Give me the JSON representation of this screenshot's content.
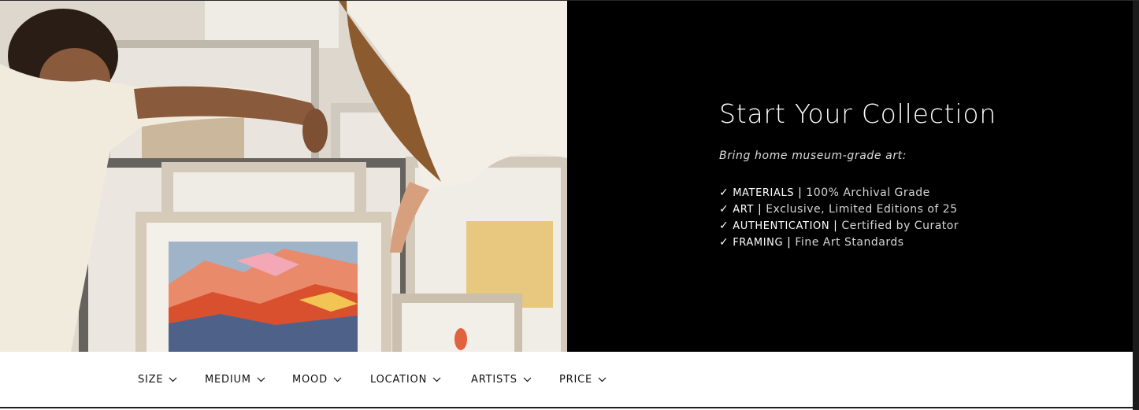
{
  "hero": {
    "title": "Start Your Collection",
    "subtitle": "Bring home museum-grade art:",
    "features": [
      {
        "key": "MATERIALS",
        "value": "100% Archival Grade"
      },
      {
        "key": "ART",
        "value": "Exclusive, Limited Editions of 25"
      },
      {
        "key": "AUTHENTICATION",
        "value": "Certified by Curator"
      },
      {
        "key": "FRAMING",
        "value": "Fine Art Standards"
      }
    ],
    "check_glyph": "✓",
    "separator": "|",
    "panel_color": "#000000"
  },
  "filters": [
    {
      "label": "SIZE",
      "icon": "chevron-down-icon"
    },
    {
      "label": "MEDIUM",
      "icon": "chevron-down-icon"
    },
    {
      "label": "MOOD",
      "icon": "chevron-down-icon"
    },
    {
      "label": "LOCATION",
      "icon": "chevron-down-icon"
    },
    {
      "label": "ARTISTS",
      "icon": "chevron-down-icon"
    },
    {
      "label": "PRICE",
      "icon": "chevron-down-icon"
    }
  ]
}
